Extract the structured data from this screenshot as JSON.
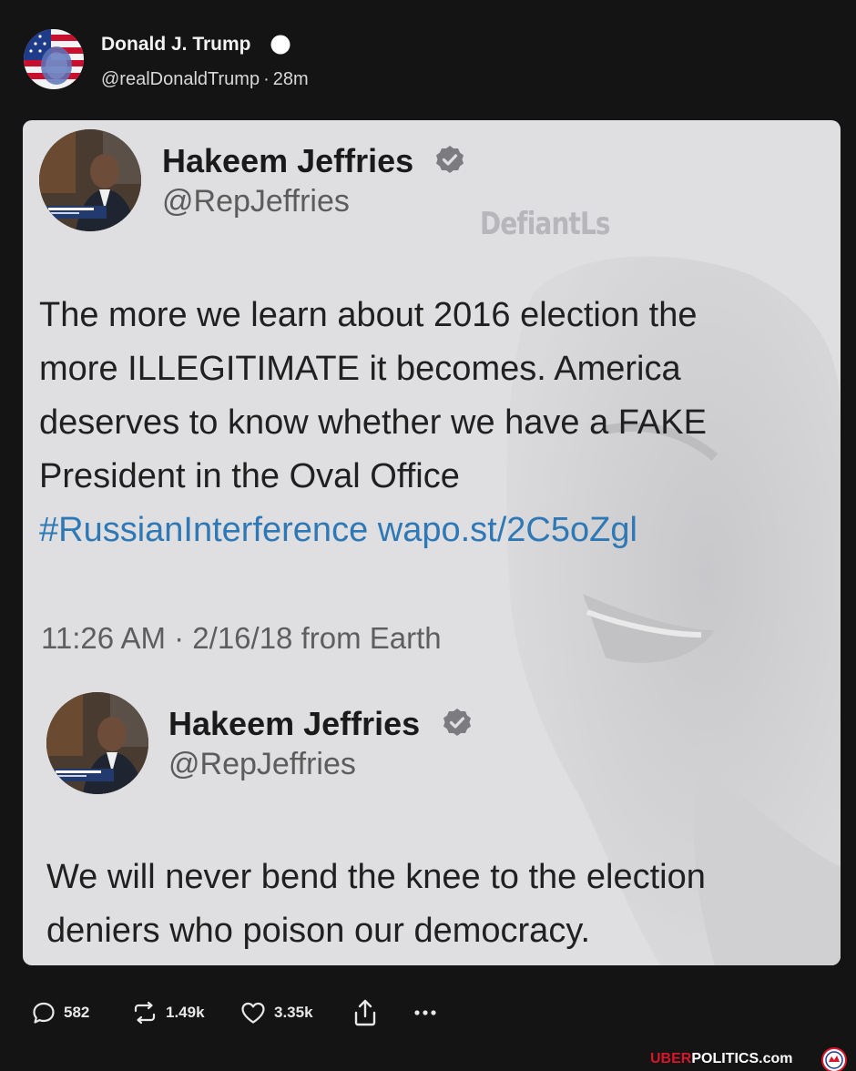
{
  "post": {
    "author_name": "Donald J. Trump",
    "handle": "@realDonaldTrump",
    "separator": "·",
    "time_ago": "28m"
  },
  "embedded": {
    "watermark": "DefiantLs",
    "tweet1": {
      "name": "Hakeem Jeffries",
      "handle": "@RepJeffries",
      "text_line1": "The more we learn about 2016 election the",
      "text_line2": "more ILLEGITIMATE it becomes. America",
      "text_line3": "deserves to know whether we have a FAKE",
      "text_line4": "President in the Oval Office",
      "hashtag": "#RussianInterference",
      "link": "wapo.st/2C5oZgl",
      "timestamp": "11:26 AM · 2/16/18 from Earth"
    },
    "tweet2": {
      "name": "Hakeem Jeffries",
      "handle": "@RepJeffries",
      "text_line1": "We will never bend the knee to the election",
      "text_line2": "deniers who poison our democracy."
    }
  },
  "actions": {
    "replies": "582",
    "reposts": "1.49k",
    "likes": "3.35k"
  },
  "footer": {
    "site_red": "UBER",
    "site_white": "POLITICS.com"
  },
  "colors": {
    "page_bg": "#141414",
    "card_bg": "#dfdfe1",
    "link_blue": "#2e78b6",
    "brand_red": "#d6162a"
  }
}
